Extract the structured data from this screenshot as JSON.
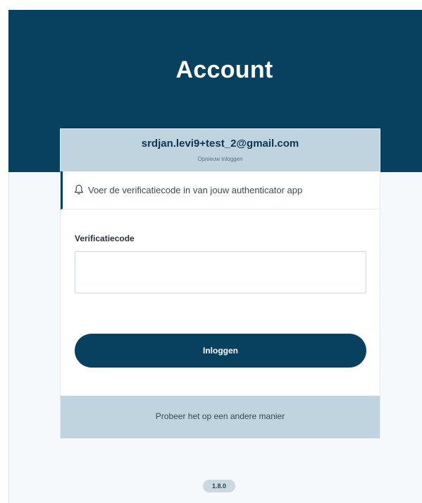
{
  "header": {
    "title": "Account"
  },
  "account": {
    "email": "srdjan.levi9+test_2@gmail.com",
    "relogin_label": "Opnieuw inloggen"
  },
  "notice": {
    "icon": "bell-icon",
    "text": "Voer de verificatiecode in van jouw authenticator app"
  },
  "form": {
    "code_label": "Verificatiecode",
    "code_value": "",
    "code_placeholder": "",
    "submit_label": "Inloggen"
  },
  "alternative": {
    "label": "Probeer het op een andere manier"
  },
  "footer": {
    "version": "1.8.0"
  },
  "colors": {
    "brand": "#08405f",
    "band": "#bfd4de",
    "background": "#f6f9fb"
  }
}
